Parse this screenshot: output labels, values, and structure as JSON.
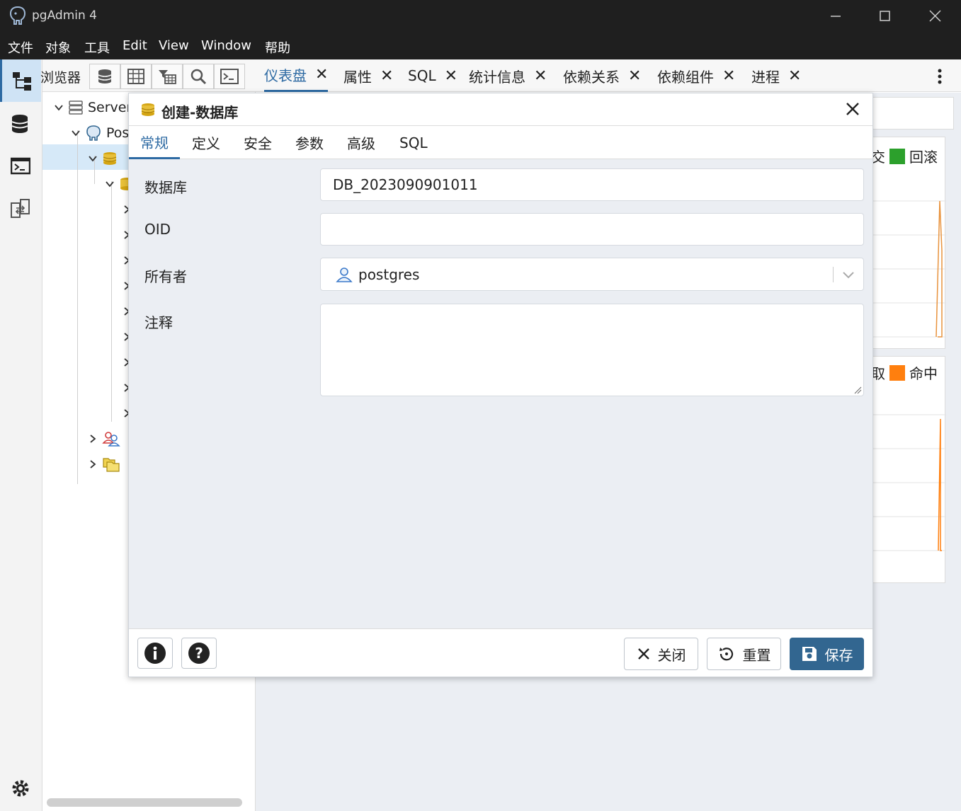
{
  "window": {
    "title": "pgAdmin 4",
    "minimize_icon": "minimize-icon",
    "maximize_icon": "maximize-icon",
    "close_icon": "close-icon"
  },
  "menu": [
    "文件",
    "对象",
    "工具",
    "Edit",
    "View",
    "Window",
    "帮助"
  ],
  "browser": {
    "title": "浏览器",
    "tree": {
      "servers": "Servers",
      "server": "PostgreSQL"
    }
  },
  "tabs": [
    {
      "label": "仪表盘",
      "active": true
    },
    {
      "label": "属性"
    },
    {
      "label": "SQL"
    },
    {
      "label": "统计信息"
    },
    {
      "label": "依赖关系"
    },
    {
      "label": "依赖组件"
    },
    {
      "label": "进程"
    }
  ],
  "dashboard": {
    "legend1": {
      "partial": "交",
      "label": "回滚",
      "color": "#2ca02c"
    },
    "legend2": {
      "partial": "取",
      "label": "命中",
      "color": "#ff7f0e"
    }
  },
  "dialog": {
    "title": "创建-数据库",
    "tabs": [
      "常规",
      "定义",
      "安全",
      "参数",
      "高级",
      "SQL"
    ],
    "fields": {
      "database_label": "数据库",
      "database_value": "DB_2023090901011",
      "oid_label": "OID",
      "oid_value": "",
      "owner_label": "所有者",
      "owner_value": "postgres",
      "comment_label": "注释",
      "comment_value": ""
    },
    "buttons": {
      "close": "关闭",
      "reset": "重置",
      "save": "保存"
    }
  },
  "colors": {
    "accent": "#2d6aa3",
    "primary_button": "#326690",
    "titlebar": "#1f1f1f"
  }
}
